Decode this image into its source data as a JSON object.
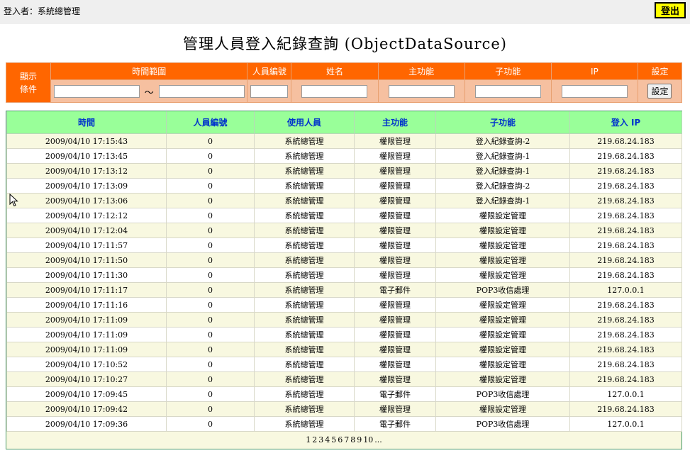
{
  "header": {
    "login_user": "登入者：系統總管理",
    "logout_label": "登出"
  },
  "title": "管理人員登入紀錄查詢 (ObjectDataSource)",
  "filter": {
    "row_label_line1": "顯示",
    "row_label_line2": "條件",
    "headers": [
      "時間範圍",
      "人員編號",
      "姓名",
      "主功能",
      "子功能",
      "IP",
      "設定"
    ],
    "tilde": "～",
    "set_button": "設定"
  },
  "grid": {
    "columns": [
      "時間",
      "人員編號",
      "使用人員",
      "主功能",
      "子功能",
      "登入 IP"
    ],
    "rows": [
      [
        "2009/04/10 17:15:43",
        "0",
        "系統總管理",
        "權限管理",
        "登入紀錄查詢-2",
        "219.68.24.183"
      ],
      [
        "2009/04/10 17:13:45",
        "0",
        "系統總管理",
        "權限管理",
        "登入紀錄查詢-1",
        "219.68.24.183"
      ],
      [
        "2009/04/10 17:13:12",
        "0",
        "系統總管理",
        "權限管理",
        "登入紀錄查詢-1",
        "219.68.24.183"
      ],
      [
        "2009/04/10 17:13:09",
        "0",
        "系統總管理",
        "權限管理",
        "登入紀錄查詢-2",
        "219.68.24.183"
      ],
      [
        "2009/04/10 17:13:06",
        "0",
        "系統總管理",
        "權限管理",
        "登入紀錄查詢-1",
        "219.68.24.183"
      ],
      [
        "2009/04/10 17:12:12",
        "0",
        "系統總管理",
        "權限管理",
        "權限設定管理",
        "219.68.24.183"
      ],
      [
        "2009/04/10 17:12:04",
        "0",
        "系統總管理",
        "權限管理",
        "權限設定管理",
        "219.68.24.183"
      ],
      [
        "2009/04/10 17:11:57",
        "0",
        "系統總管理",
        "權限管理",
        "權限設定管理",
        "219.68.24.183"
      ],
      [
        "2009/04/10 17:11:50",
        "0",
        "系統總管理",
        "權限管理",
        "權限設定管理",
        "219.68.24.183"
      ],
      [
        "2009/04/10 17:11:30",
        "0",
        "系統總管理",
        "權限管理",
        "權限設定管理",
        "219.68.24.183"
      ],
      [
        "2009/04/10 17:11:17",
        "0",
        "系統總管理",
        "電子郵件",
        "POP3收信處理",
        "127.0.0.1"
      ],
      [
        "2009/04/10 17:11:16",
        "0",
        "系統總管理",
        "權限管理",
        "權限設定管理",
        "219.68.24.183"
      ],
      [
        "2009/04/10 17:11:09",
        "0",
        "系統總管理",
        "權限管理",
        "權限設定管理",
        "219.68.24.183"
      ],
      [
        "2009/04/10 17:11:09",
        "0",
        "系統總管理",
        "權限管理",
        "權限設定管理",
        "219.68.24.183"
      ],
      [
        "2009/04/10 17:11:09",
        "0",
        "系統總管理",
        "權限管理",
        "權限設定管理",
        "219.68.24.183"
      ],
      [
        "2009/04/10 17:10:52",
        "0",
        "系統總管理",
        "權限管理",
        "權限設定管理",
        "219.68.24.183"
      ],
      [
        "2009/04/10 17:10:27",
        "0",
        "系統總管理",
        "權限管理",
        "權限設定管理",
        "219.68.24.183"
      ],
      [
        "2009/04/10 17:09:45",
        "0",
        "系統總管理",
        "電子郵件",
        "POP3收信處理",
        "127.0.0.1"
      ],
      [
        "2009/04/10 17:09:42",
        "0",
        "系統總管理",
        "權限管理",
        "權限設定管理",
        "219.68.24.183"
      ],
      [
        "2009/04/10 17:09:36",
        "0",
        "系統總管理",
        "電子郵件",
        "POP3收信處理",
        "127.0.0.1"
      ]
    ]
  },
  "pager": {
    "pages": [
      "1",
      "2",
      "3",
      "4",
      "5",
      "6",
      "7",
      "8",
      "9",
      "10",
      "..."
    ]
  },
  "colors": {
    "filter_header": "#ff6600",
    "filter_input_row": "#f6c0a0",
    "grid_header": "#99ff99",
    "grid_header_text": "#0033cc",
    "row_odd": "#f8f8e0",
    "row_even": "#ffffff",
    "logout_bg": "#ffff00"
  },
  "icons": {
    "cursor": "mouse-pointer-icon"
  }
}
